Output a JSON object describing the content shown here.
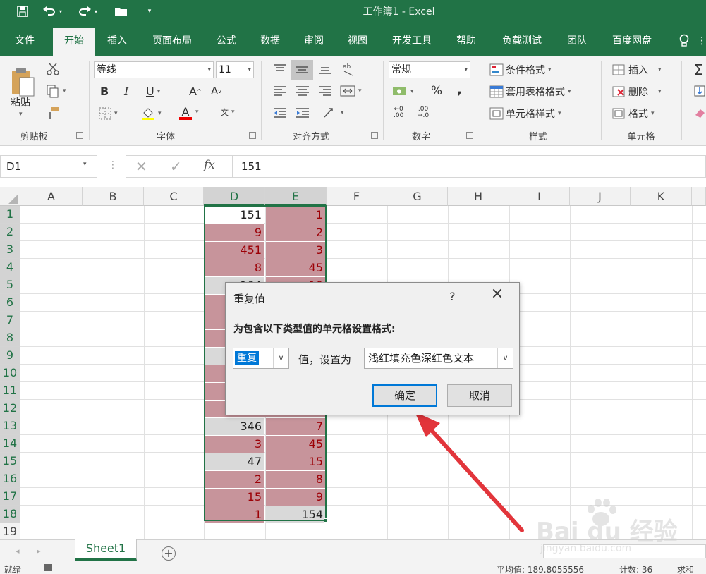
{
  "titlebar": {
    "title": "工作簿1  -  Excel"
  },
  "tabs": [
    "文件",
    "开始",
    "插入",
    "页面布局",
    "公式",
    "数据",
    "审阅",
    "视图",
    "开发工具",
    "帮助",
    "负载测试",
    "团队",
    "百度网盘"
  ],
  "ribbon": {
    "clipboard": {
      "paste": "粘贴",
      "label": "剪贴板"
    },
    "font": {
      "name": "等线",
      "size": "11",
      "label": "字体"
    },
    "alignment": {
      "label": "对齐方式"
    },
    "number": {
      "format": "常规",
      "label": "数字",
      "percent": "%",
      "comma": ","
    },
    "styles": {
      "conditional": "条件格式",
      "table": "套用表格格式",
      "cell": "单元格样式",
      "label": "样式"
    },
    "cells": {
      "insert": "插入",
      "delete": "删除",
      "format": "格式",
      "label": "单元格"
    }
  },
  "formula_bar": {
    "name_box": "D1",
    "value": "151",
    "fx": "fx"
  },
  "grid": {
    "columns": [
      "A",
      "B",
      "C",
      "D",
      "E",
      "F",
      "G",
      "H",
      "I",
      "J",
      "K"
    ],
    "rows": [
      "1",
      "2",
      "3",
      "4",
      "5",
      "6",
      "7",
      "8",
      "9",
      "10",
      "11",
      "12",
      "13",
      "14",
      "15",
      "16",
      "17",
      "18",
      "19"
    ],
    "visible_cells": {
      "d1": "151",
      "e1": "1",
      "d2": "9",
      "e2": "2",
      "d3": "451",
      "e3": "3",
      "d4": "8",
      "e4": "45",
      "d5": "104",
      "e5": "10",
      "d13": "346",
      "e13": "7",
      "d14": "3",
      "e14": "45",
      "d15": "47",
      "e15": "15",
      "d16": "2",
      "e16": "8",
      "d17": "15",
      "e17": "9",
      "d18": "1",
      "e18": "154"
    }
  },
  "sheets": {
    "active": "Sheet1",
    "add": "+"
  },
  "statusbar": {
    "left": "就绪",
    "average": "平均值: 189.8055556",
    "count": "计数: 36",
    "sum": "求和"
  },
  "dialog": {
    "title": "重复值",
    "help": "?",
    "prompt": "为包含以下类型值的单元格设置格式:",
    "type_value": "重复",
    "middle": "值，设置为",
    "format_value": "浅红填充色深红色文本",
    "ok": "确定",
    "cancel": "取消"
  },
  "watermark": {
    "brand": "Bai du 经验",
    "url": "jingyan.baidu.com"
  },
  "colors": {
    "excel_green": "#217346",
    "dup_fill": "#c7949b",
    "dup_text": "#9c0006",
    "arrow": "#e2353b"
  }
}
